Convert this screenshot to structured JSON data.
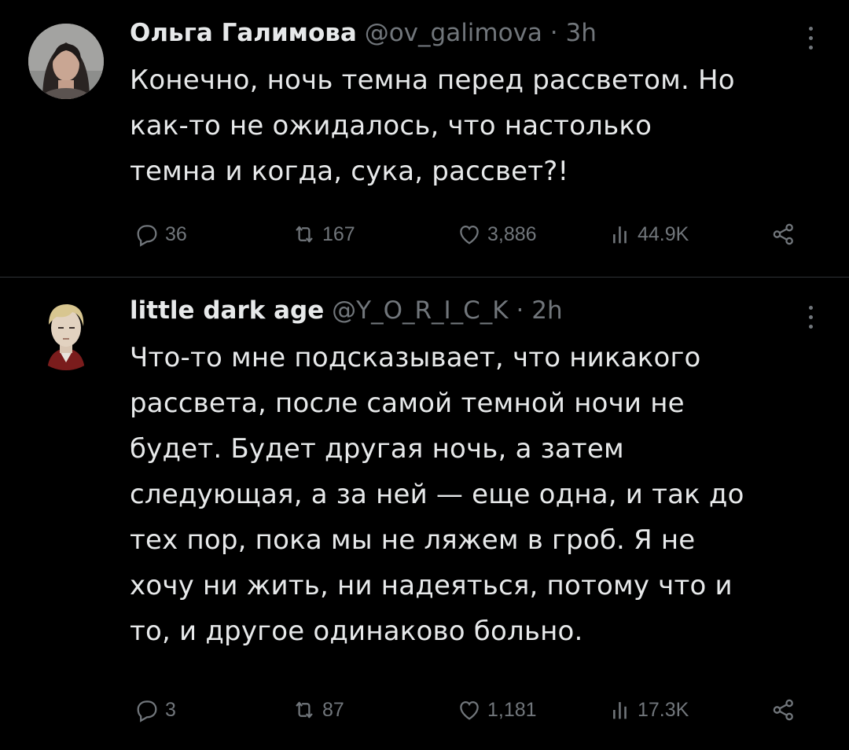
{
  "tweets": [
    {
      "display_name": "Ольга Галимова",
      "handle": "@ov_galimova",
      "separator": "·",
      "time": "3h",
      "text": "Конечно, ночь темна перед рассветом. Но\nкак-то не ожидалось, что настолько\nтемна и когда, сука, рассвет?!",
      "replies": "36",
      "retweets": "167",
      "likes": "3,886",
      "views": "44.9K",
      "avatar_icon": "woman-portrait-avatar"
    },
    {
      "display_name": "little dark age",
      "handle": "@Y_O_R_I_C_K",
      "separator": "·",
      "time": "2h",
      "text": "Что-то мне подсказывает, что никакого\nрассвета, после самой темной ночи не\nбудет. Будет другая ночь, а затем\nследующая, а за ней — еще одна, и так до\nтех пор, пока мы не ляжем в гроб. Я не\nхочу ни жить, ни надеяться, потому что и\nто, и другое одинаково больно.",
      "replies": "3",
      "retweets": "87",
      "likes": "1,181",
      "views": "17.3K",
      "avatar_icon": "anime-character-avatar"
    }
  ],
  "colors": {
    "background": "#000000",
    "text_primary": "#e7e9ea",
    "text_secondary": "#71767b",
    "divider": "#2f3336"
  },
  "icons": {
    "reply": "reply-icon",
    "retweet": "retweet-icon",
    "like": "heart-icon",
    "views": "views-icon",
    "share": "share-icon",
    "more": "more-icon"
  }
}
